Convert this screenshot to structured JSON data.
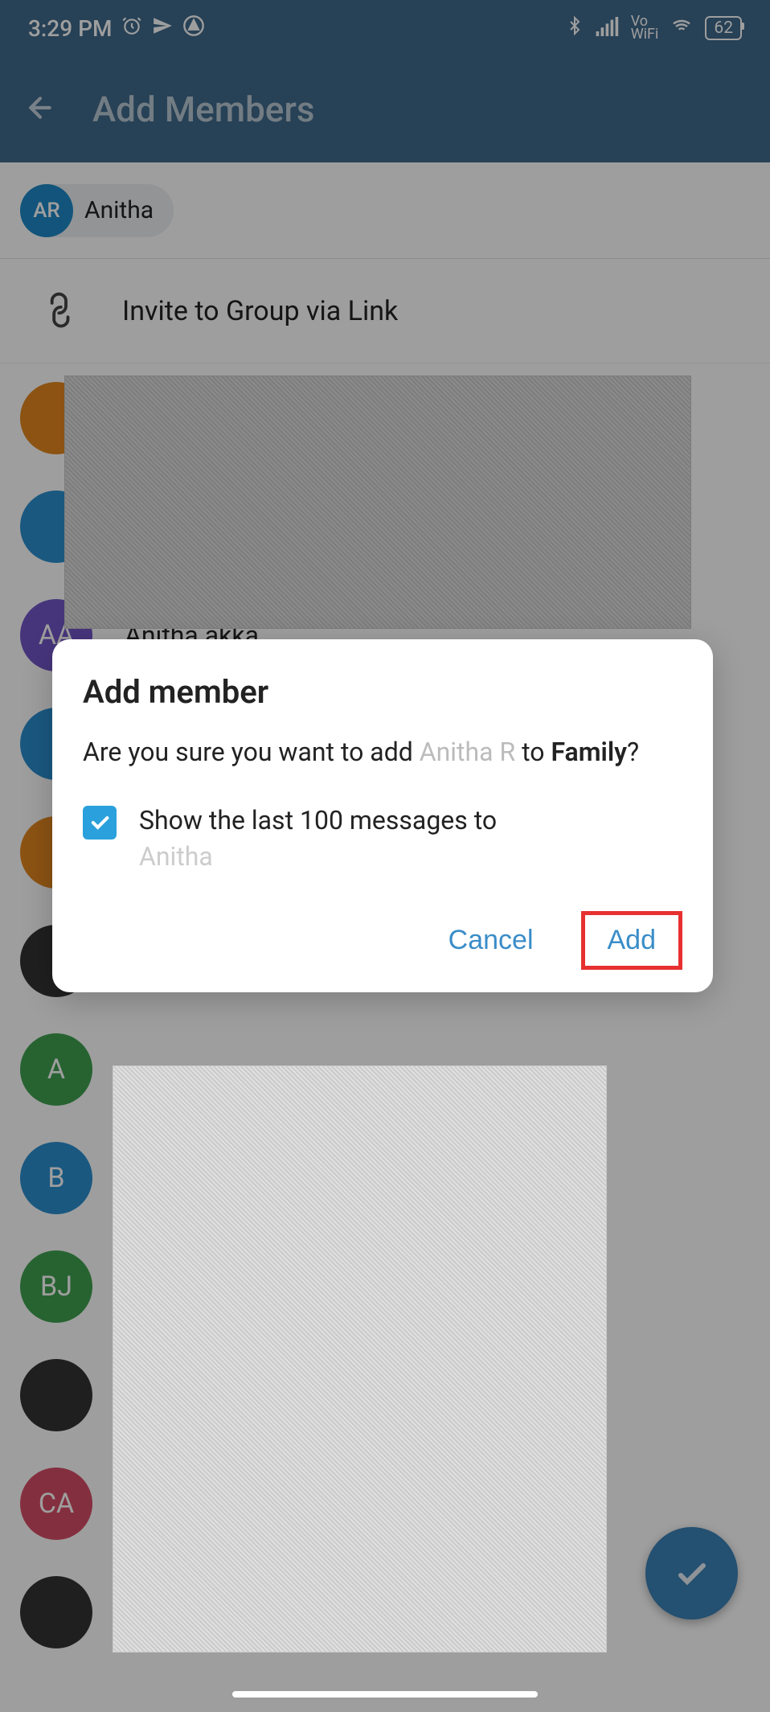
{
  "status": {
    "time": "3:29 PM",
    "battery": "62",
    "vowifi_top": "Vo",
    "vowifi_bottom": "WiFi"
  },
  "header": {
    "title": "Add Members"
  },
  "chip": {
    "initials": "AR",
    "name": "Anitha"
  },
  "invite": {
    "label": "Invite to Group via Link"
  },
  "contacts": [
    {
      "initials": "",
      "color": "av-orange",
      "name": ""
    },
    {
      "initials": "",
      "color": "av-blue",
      "name": ""
    },
    {
      "initials": "AA",
      "color": "av-purple",
      "name": "Anitha akka"
    },
    {
      "initials": "",
      "color": "av-blue",
      "name": ""
    },
    {
      "initials": "",
      "color": "av-orange",
      "name": ""
    },
    {
      "initials": "",
      "color": "av-photo",
      "name": ""
    },
    {
      "initials": "A",
      "color": "av-green",
      "name": ""
    },
    {
      "initials": "B",
      "color": "av-blue",
      "name": ""
    },
    {
      "initials": "BJ",
      "color": "av-green",
      "name": ""
    },
    {
      "initials": "",
      "color": "av-photo",
      "name": ""
    },
    {
      "initials": "CA",
      "color": "av-pink",
      "name": ""
    },
    {
      "initials": "",
      "color": "av-photo",
      "name": ""
    }
  ],
  "dialog": {
    "title": "Add member",
    "body_prefix": "Are you sure you want to add ",
    "body_member": "Anitha R",
    "body_mid": " to ",
    "body_group": "Family",
    "body_suffix": "?",
    "checkbox_text": "Show the last 100 messages to ",
    "checkbox_name": "Anitha",
    "cancel": "Cancel",
    "add": "Add"
  }
}
